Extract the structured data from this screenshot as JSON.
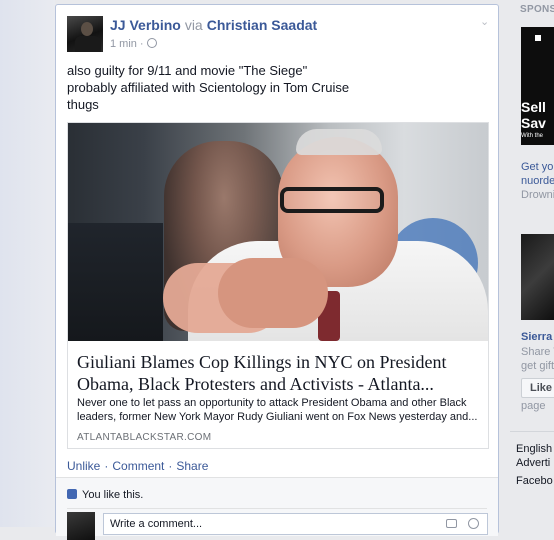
{
  "post": {
    "author": "JJ Verbino",
    "via": "via",
    "source": "Christian Saadat",
    "time": "1 min",
    "dot": "·",
    "text_lines": [
      "also guilty for 9/11 and movie \"The Siege\"",
      "probably affiliated with Scientology in Tom Cruise",
      "thugs"
    ],
    "link": {
      "title_lines": [
        "Giuliani Blames Cop Killings in NYC on President",
        "Obama, Black Protesters and Activists - Atlanta..."
      ],
      "desc_lines": [
        "Never one to let pass an opportunity to attack President Obama and other Black",
        "leaders, former New York Mayor Rudy Giuliani went on Fox News yesterday and..."
      ],
      "domain": "ATLANTABLACKSTAR.COM"
    },
    "actions": {
      "unlike": "Unlike",
      "comment": "Comment",
      "share": "Share",
      "separator": "·"
    },
    "likes_text": "You like this.",
    "comment_placeholder": "Write a comment..."
  },
  "sidebar": {
    "sponsored_label": "SPONSO",
    "ad1": {
      "line1": "Sell",
      "line2": "Sav",
      "line3": "With the",
      "link_lines": [
        "Get yo",
        "nuorde"
      ],
      "sub": "Drowni"
    },
    "ad2": {
      "title": "Sierra",
      "sub_lines": [
        "Share T",
        "get gift"
      ],
      "like_label": "Like",
      "page_label": "page"
    },
    "footer_lines": [
      "English",
      "Adverti"
    ],
    "footer2": "Facebo"
  },
  "colors": {
    "link": "#3b5998",
    "meta": "#9197a3",
    "background": "#e9eaed"
  }
}
